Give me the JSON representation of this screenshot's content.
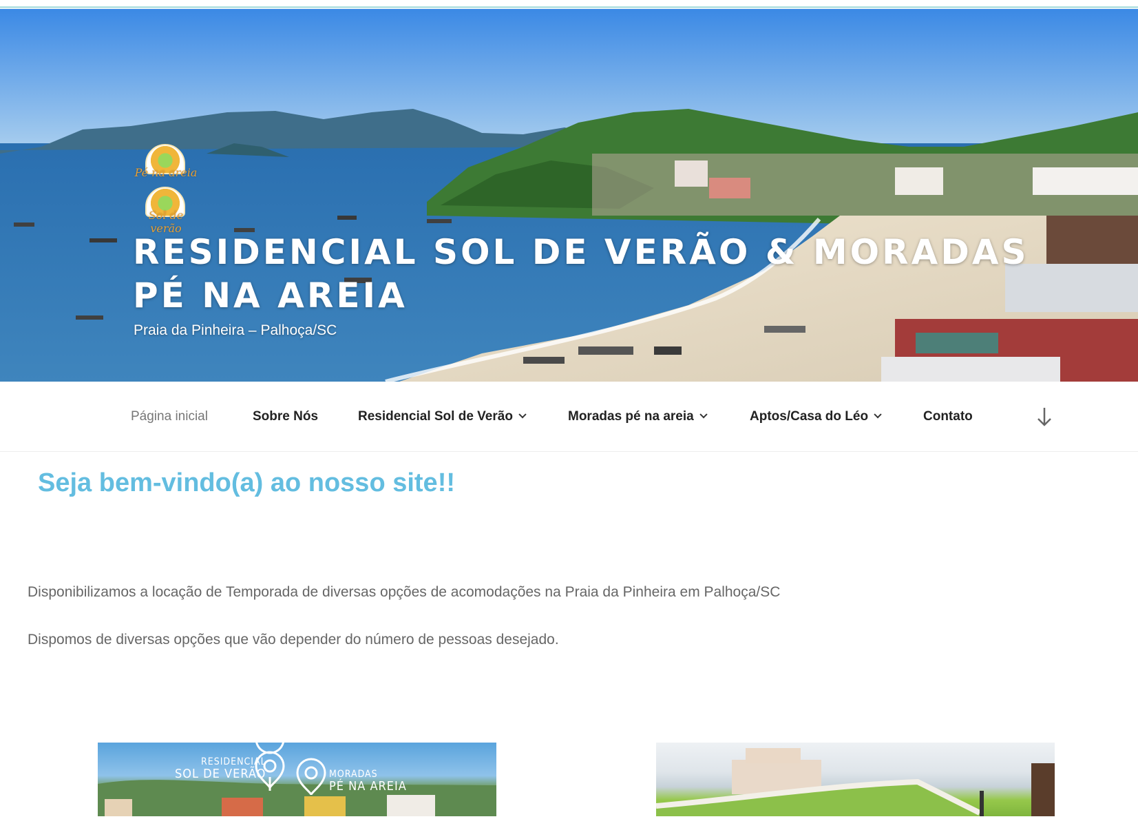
{
  "site": {
    "title": "RESIDENCIAL SOL DE VERÃO & MORADAS PÉ NA AREIA",
    "description": "Praia da Pinheira – Palhoça/SC",
    "logos": [
      {
        "label": "Pé na areia"
      },
      {
        "label": "Sol de verão"
      }
    ]
  },
  "nav": {
    "items": [
      {
        "label": "Página inicial",
        "current": true,
        "submenu": false
      },
      {
        "label": "Sobre Nós",
        "current": false,
        "submenu": false
      },
      {
        "label": "Residencial Sol de Verão",
        "current": false,
        "submenu": true
      },
      {
        "label": "Moradas pé na areia",
        "current": false,
        "submenu": true
      },
      {
        "label": "Aptos/Casa do Léo",
        "current": false,
        "submenu": true
      },
      {
        "label": "Contato",
        "current": false,
        "submenu": false
      }
    ],
    "scroll_icon": "arrow-down-icon"
  },
  "content": {
    "heading": "Seja bem-vindo(a) ao nosso site!!",
    "paragraphs": [
      "Disponibilizamos a locação de Temporada de diversas opções de acomodações na Praia da Pinheira em Palhoça/SC",
      "Dispomos de diversas opções que vão depender do número de pessoas desejado."
    ],
    "thumb1": {
      "left_text_1": "RESIDENCIAL",
      "left_text_2": "SOL DE VERÃO",
      "right_text_1": "MORADAS",
      "right_text_2": "PÉ NA AREIA"
    }
  },
  "colors": {
    "accent": "#63bde0",
    "nav_text": "#222222",
    "body_text": "#666666"
  }
}
